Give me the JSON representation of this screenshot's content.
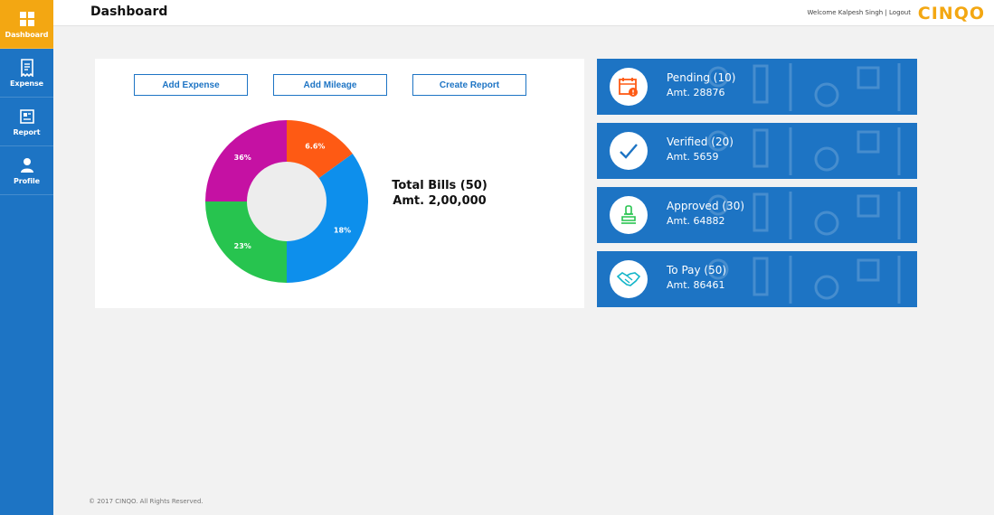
{
  "sidebar": {
    "items": [
      {
        "label": "Dashboard",
        "icon": "dashboard-grid-icon"
      },
      {
        "label": "Expense",
        "icon": "receipt-icon"
      },
      {
        "label": "Report",
        "icon": "report-icon"
      },
      {
        "label": "Profile",
        "icon": "user-icon"
      }
    ]
  },
  "header": {
    "title": "Dashboard",
    "welcome": "Welcome Kalpesh Singh | Logout",
    "logo_text": "CINQO"
  },
  "actions": {
    "add_expense": "Add Expense",
    "add_mileage": "Add Mileage",
    "create_report": "Create Report"
  },
  "chart_data": {
    "type": "pie",
    "categories": [
      "6.6%",
      "18%",
      "23%",
      "36%"
    ],
    "values": [
      6.6,
      18,
      23,
      36
    ],
    "display_shares": [
      0.15,
      0.35,
      0.25,
      0.25
    ],
    "colors": [
      "#fe5a14",
      "#0d8fec",
      "#27c44f",
      "#c511a3"
    ],
    "center_color": "#ededed"
  },
  "summary": {
    "total_bills": "Total Bills (50)",
    "total_amount": "Amt. 2,00,000"
  },
  "cards": [
    {
      "title": "Pending (10)",
      "amount": "Amt. 28876",
      "icon": "calendar-alert-icon",
      "color": "#fe5a14"
    },
    {
      "title": "Verified (20)",
      "amount": "Amt. 5659",
      "icon": "checkmark-icon",
      "color": "#1d74c4"
    },
    {
      "title": "Approved (30)",
      "amount": "Amt. 64882",
      "icon": "stamp-icon",
      "color": "#27c44f"
    },
    {
      "title": "To Pay (50)",
      "amount": "Amt. 86461",
      "icon": "handshake-icon",
      "color": "#12b5c9"
    }
  ],
  "footer": "© 2017 CINQO. All Rights Reserved.",
  "colors": {
    "brand_blue": "#1d74c4",
    "brand_orange": "#f3a712",
    "background": "#f2f2f2"
  }
}
